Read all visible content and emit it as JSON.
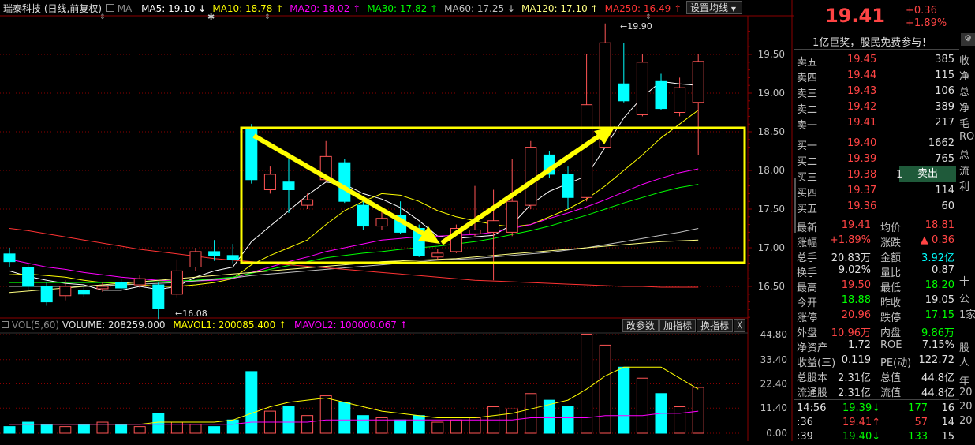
{
  "header": {
    "stock_name": "瑞泰科技",
    "mode": "(日线,前复权)",
    "ma_label": "MA",
    "ma_items": [
      {
        "label": "MA5: 19.10",
        "arrow": "↓",
        "color": "#ffffff"
      },
      {
        "label": "MA10: 18.78",
        "arrow": "↑",
        "color": "#ffff00"
      },
      {
        "label": "MA20: 18.02",
        "arrow": "↑",
        "color": "#ff00ff"
      },
      {
        "label": "MA30: 17.82",
        "arrow": "↑",
        "color": "#00ff00"
      },
      {
        "label": "MA60: 17.25",
        "arrow": "↓",
        "color": "#c0c0c0"
      },
      {
        "label": "MA120: 17.10",
        "arrow": "↑",
        "color": "#ffff80"
      },
      {
        "label": "MA250: 16.49",
        "arrow": "↑",
        "color": "#ff3333"
      }
    ],
    "settings_button": "设置均线"
  },
  "vol_header": {
    "label": "VOL(5,60)",
    "volume": "VOLUME: 208259.000",
    "mavol1": "MAVOL1: 200085.400",
    "mavol2": "MAVOL2: 100000.067",
    "buttons": [
      "改参数",
      "加指标",
      "换指标"
    ],
    "close_glyph": "╳"
  },
  "annotations": {
    "high": "19.90",
    "low": "16.08"
  },
  "colors": {
    "up": "#ff5555",
    "down": "#00ffff",
    "box": "#ffff00"
  },
  "chart_data": {
    "type": "candlestick",
    "price_axis": {
      "ticks": [
        "19.50",
        "19.00",
        "18.50",
        "18.00",
        "17.50",
        "17.00",
        "16.50"
      ],
      "ylim": [
        16.08,
        19.9
      ]
    },
    "volume_axis": {
      "ticks": [
        "44.80",
        "33.40",
        "22.40",
        "11.40",
        "0.00"
      ]
    },
    "candles": [
      {
        "o": 16.92,
        "c": 16.82,
        "h": 17.0,
        "l": 16.75
      },
      {
        "o": 16.75,
        "c": 16.5,
        "h": 16.8,
        "l": 16.45
      },
      {
        "o": 16.5,
        "c": 16.3,
        "h": 16.55,
        "l": 16.25
      },
      {
        "o": 16.38,
        "c": 16.5,
        "h": 16.58,
        "l": 16.32
      },
      {
        "o": 16.45,
        "c": 16.4,
        "h": 16.52,
        "l": 16.36
      },
      {
        "o": 16.47,
        "c": 16.5,
        "h": 16.56,
        "l": 16.43
      },
      {
        "o": 16.55,
        "c": 16.48,
        "h": 16.6,
        "l": 16.45
      },
      {
        "o": 16.52,
        "c": 16.6,
        "h": 16.65,
        "l": 16.48
      },
      {
        "o": 16.52,
        "c": 16.21,
        "h": 16.55,
        "l": 16.08
      },
      {
        "o": 16.4,
        "c": 16.7,
        "h": 16.85,
        "l": 16.35
      },
      {
        "o": 16.75,
        "c": 16.95,
        "h": 17.0,
        "l": 16.7
      },
      {
        "o": 16.95,
        "c": 16.9,
        "h": 17.1,
        "l": 16.83
      },
      {
        "o": 16.9,
        "c": 16.85,
        "h": 17.05,
        "l": 16.8
      },
      {
        "o": 18.53,
        "c": 17.88,
        "h": 18.6,
        "l": 17.83
      },
      {
        "o": 17.75,
        "c": 17.95,
        "h": 18.05,
        "l": 17.7
      },
      {
        "o": 17.85,
        "c": 17.75,
        "h": 18.15,
        "l": 17.45
      },
      {
        "o": 17.55,
        "c": 17.62,
        "h": 17.7,
        "l": 17.5
      },
      {
        "o": 17.88,
        "c": 18.18,
        "h": 18.38,
        "l": 17.85
      },
      {
        "o": 18.1,
        "c": 17.6,
        "h": 18.15,
        "l": 17.58
      },
      {
        "o": 17.55,
        "c": 17.28,
        "h": 17.6,
        "l": 17.23
      },
      {
        "o": 17.28,
        "c": 17.38,
        "h": 17.5,
        "l": 17.23
      },
      {
        "o": 17.42,
        "c": 17.2,
        "h": 17.6,
        "l": 17.18
      },
      {
        "o": 17.25,
        "c": 16.9,
        "h": 17.3,
        "l": 16.88
      },
      {
        "o": 16.88,
        "c": 16.93,
        "h": 16.98,
        "l": 16.85
      },
      {
        "o": 16.95,
        "c": 17.25,
        "h": 17.3,
        "l": 16.93
      },
      {
        "o": 17.18,
        "c": 17.23,
        "h": 17.8,
        "l": 17.15
      },
      {
        "o": 17.2,
        "c": 17.35,
        "h": 17.75,
        "l": 16.58
      },
      {
        "o": 17.2,
        "c": 17.6,
        "h": 18.15,
        "l": 17.15
      },
      {
        "o": 17.55,
        "c": 18.3,
        "h": 18.38,
        "l": 17.5
      },
      {
        "o": 18.2,
        "c": 17.95,
        "h": 18.25,
        "l": 17.9
      },
      {
        "o": 17.95,
        "c": 17.65,
        "h": 18.05,
        "l": 17.5
      },
      {
        "o": 17.65,
        "c": 18.85,
        "h": 19.5,
        "l": 17.6
      },
      {
        "o": 18.3,
        "c": 19.65,
        "h": 19.9,
        "l": 18.35
      },
      {
        "o": 19.12,
        "c": 18.9,
        "h": 19.65,
        "l": 18.88
      },
      {
        "o": 18.72,
        "c": 19.4,
        "h": 19.5,
        "l": 18.7
      },
      {
        "o": 19.15,
        "c": 18.8,
        "h": 19.25,
        "l": 18.78
      },
      {
        "o": 18.75,
        "c": 19.07,
        "h": 19.2,
        "l": 18.7
      },
      {
        "o": 18.88,
        "c": 19.41,
        "h": 19.5,
        "l": 18.2
      }
    ],
    "volumes": [
      3,
      5,
      4,
      3,
      4,
      5,
      4,
      3,
      9,
      5,
      4,
      3,
      6,
      28,
      10,
      12,
      8,
      17,
      14,
      8,
      7,
      6,
      8,
      5,
      6,
      7,
      12,
      11,
      18,
      15,
      12,
      45,
      40,
      30,
      25,
      18,
      12,
      20.8
    ],
    "ma_lines": [
      {
        "name": "MA5",
        "color": "#ffffff",
        "values": [
          16.7,
          16.63,
          16.58,
          16.54,
          16.52,
          16.45,
          16.45,
          16.5,
          16.46,
          16.5,
          16.62,
          16.7,
          16.75,
          17.08,
          17.28,
          17.48,
          17.68,
          17.85,
          17.82,
          17.7,
          17.63,
          17.52,
          17.35,
          17.15,
          17.12,
          17.14,
          17.16,
          17.3,
          17.56,
          17.73,
          17.83,
          17.93,
          18.3,
          18.68,
          18.95,
          19.15,
          19.12,
          19.1
        ]
      },
      {
        "name": "MA10",
        "color": "#ffff00",
        "values": [
          16.65,
          16.66,
          16.64,
          16.62,
          16.58,
          16.55,
          16.54,
          16.52,
          16.5,
          16.5,
          16.52,
          16.55,
          16.6,
          16.78,
          16.9,
          17.0,
          17.1,
          17.3,
          17.48,
          17.6,
          17.7,
          17.68,
          17.6,
          17.48,
          17.4,
          17.35,
          17.3,
          17.27,
          17.3,
          17.4,
          17.5,
          17.63,
          17.8,
          18.0,
          18.2,
          18.42,
          18.6,
          18.78
        ]
      },
      {
        "name": "MA20",
        "color": "#ff00ff",
        "values": [
          16.85,
          16.8,
          16.75,
          16.72,
          16.68,
          16.65,
          16.62,
          16.6,
          16.58,
          16.57,
          16.57,
          16.58,
          16.6,
          16.68,
          16.75,
          16.82,
          16.88,
          16.95,
          17.0,
          17.05,
          17.1,
          17.12,
          17.14,
          17.15,
          17.16,
          17.17,
          17.2,
          17.25,
          17.3,
          17.38,
          17.45,
          17.53,
          17.62,
          17.72,
          17.82,
          17.9,
          17.97,
          18.02
        ]
      },
      {
        "name": "MA30",
        "color": "#00ff00",
        "values": [
          16.55,
          16.55,
          16.55,
          16.55,
          16.55,
          16.55,
          16.55,
          16.56,
          16.56,
          16.57,
          16.58,
          16.6,
          16.62,
          16.67,
          16.72,
          16.77,
          16.82,
          16.87,
          16.9,
          16.93,
          16.95,
          16.98,
          17.0,
          17.02,
          17.05,
          17.08,
          17.12,
          17.17,
          17.22,
          17.28,
          17.35,
          17.42,
          17.5,
          17.58,
          17.65,
          17.72,
          17.78,
          17.82
        ]
      },
      {
        "name": "MA60",
        "color": "#c0c0c0",
        "values": [
          16.5,
          16.5,
          16.5,
          16.5,
          16.5,
          16.51,
          16.52,
          16.53,
          16.54,
          16.55,
          16.57,
          16.59,
          16.61,
          16.64,
          16.66,
          16.68,
          16.7,
          16.72,
          16.74,
          16.76,
          16.78,
          16.8,
          16.82,
          16.84,
          16.85,
          16.86,
          16.88,
          16.9,
          16.92,
          16.94,
          16.97,
          17.0,
          17.04,
          17.08,
          17.12,
          17.16,
          17.2,
          17.25
        ]
      },
      {
        "name": "MA120",
        "color": "#ffff80",
        "values": [
          16.42,
          16.44,
          16.46,
          16.48,
          16.5,
          16.52,
          16.54,
          16.56,
          16.58,
          16.6,
          16.62,
          16.64,
          16.66,
          16.68,
          16.7,
          16.72,
          16.74,
          16.76,
          16.78,
          16.8,
          16.82,
          16.83,
          16.84,
          16.85,
          16.86,
          16.88,
          16.9,
          16.92,
          16.94,
          16.96,
          16.98,
          17.0,
          17.02,
          17.04,
          17.06,
          17.08,
          17.09,
          17.1
        ]
      },
      {
        "name": "MA250",
        "color": "#ff3333",
        "values": [
          17.25,
          17.22,
          17.18,
          17.14,
          17.1,
          17.06,
          17.02,
          16.98,
          16.95,
          16.92,
          16.89,
          16.86,
          16.84,
          16.82,
          16.8,
          16.78,
          16.76,
          16.74,
          16.72,
          16.7,
          16.68,
          16.66,
          16.64,
          16.62,
          16.6,
          16.58,
          16.57,
          16.56,
          16.55,
          16.54,
          16.53,
          16.52,
          16.51,
          16.5,
          16.5,
          16.49,
          16.49,
          16.49
        ]
      }
    ],
    "vol_ma_lines": [
      {
        "name": "MAVOL1",
        "color": "#ffff00",
        "values": [
          4,
          4,
          4,
          4,
          4,
          4,
          4,
          4,
          5,
          5,
          5,
          5,
          6,
          9,
          12,
          14,
          15,
          16,
          14,
          12,
          10,
          9,
          8,
          7,
          7,
          7,
          8,
          9,
          11,
          13,
          15,
          20,
          26,
          30,
          30,
          30,
          25,
          20
        ]
      },
      {
        "name": "MAVOL2",
        "color": "#ff00ff",
        "values": [
          4,
          4,
          4,
          4,
          4,
          4,
          4,
          4,
          4,
          4,
          4,
          4,
          4,
          5,
          5,
          5,
          5,
          6,
          6,
          6,
          6,
          6,
          6,
          6,
          6,
          6,
          6,
          6,
          7,
          7,
          7,
          7,
          8,
          8,
          8,
          9,
          9,
          10
        ]
      }
    ]
  },
  "quote": {
    "price": "19.41",
    "change": "+0.36",
    "change_pct": "+1.89%",
    "promo": "1亿巨奖，股民免费参与！",
    "asks": [
      {
        "label": "卖五",
        "price": "19.45",
        "vol": "385"
      },
      {
        "label": "卖四",
        "price": "19.44",
        "vol": "115"
      },
      {
        "label": "卖三",
        "price": "19.43",
        "vol": "106"
      },
      {
        "label": "卖二",
        "price": "19.42",
        "vol": "389"
      },
      {
        "label": "卖一",
        "price": "19.41",
        "vol": "217"
      }
    ],
    "bids": [
      {
        "label": "买一",
        "price": "19.40",
        "vol": "1662"
      },
      {
        "label": "买二",
        "price": "19.39",
        "vol": "765"
      },
      {
        "label": "买三",
        "price": "19.38",
        "vol": "1"
      },
      {
        "label": "买四",
        "price": "19.37",
        "vol": "114"
      },
      {
        "label": "买五",
        "price": "19.36",
        "vol": "60"
      }
    ],
    "sell_button": "卖出",
    "stats": [
      {
        "l1": "最新",
        "v1": "19.41",
        "c1": "#ff4444",
        "l2": "均价",
        "v2": "18.81",
        "c2": "#ff4444"
      },
      {
        "l1": "涨幅",
        "v1": "+1.89%",
        "c1": "#ff4444",
        "l2": "涨跌",
        "v2": "▲ 0.36",
        "c2": "#ff4444"
      },
      {
        "l1": "总手",
        "v1": "20.83万",
        "c1": "#e0e0e0",
        "l2": "金额",
        "v2": "3.92亿",
        "c2": "#00ffff"
      },
      {
        "l1": "换手",
        "v1": "9.02%",
        "c1": "#e0e0e0",
        "l2": "量比",
        "v2": "0.87",
        "c2": "#e0e0e0"
      },
      {
        "l1": "最高",
        "v1": "19.50",
        "c1": "#ff4444",
        "l2": "最低",
        "v2": "18.20",
        "c2": "#00ff00"
      },
      {
        "l1": "今开",
        "v1": "18.88",
        "c1": "#00ff00",
        "l2": "昨收",
        "v2": "19.05",
        "c2": "#e0e0e0"
      },
      {
        "l1": "涨停",
        "v1": "20.96",
        "c1": "#ff4444",
        "l2": "跌停",
        "v2": "17.15",
        "c2": "#00ff00"
      },
      {
        "l1": "外盘",
        "v1": "10.96万",
        "c1": "#ff4444",
        "l2": "内盘",
        "v2": "9.86万",
        "c2": "#00ff00"
      },
      {
        "l1": "净资产",
        "v1": "1.72",
        "c1": "#e0e0e0",
        "l2": "ROE",
        "v2": "7.15%",
        "c2": "#e0e0e0"
      },
      {
        "l1": "收益(三)",
        "v1": "0.119",
        "c1": "#e0e0e0",
        "l2": "PE(动)",
        "v2": "122.72",
        "c2": "#e0e0e0"
      },
      {
        "l1": "总股本",
        "v1": "2.31亿",
        "c1": "#e0e0e0",
        "l2": "总值",
        "v2": "44.8亿",
        "c2": "#e0e0e0"
      },
      {
        "l1": "流通股",
        "v1": "2.31亿",
        "c1": "#e0e0e0",
        "l2": "流值",
        "v2": "44.8亿",
        "c2": "#e0e0e0"
      }
    ],
    "ticks": [
      {
        "time": "14:56",
        "price": "19.39",
        "arrow": "↓",
        "vol": "177",
        "num": "16",
        "color": "#00ff00"
      },
      {
        "time": ":36",
        "price": "19.41",
        "arrow": "↑",
        "vol": "57",
        "num": "14",
        "color": "#ff4444"
      },
      {
        "time": ":39",
        "price": "19.40",
        "arrow": "↓",
        "vol": "133",
        "num": "15",
        "color": "#00ff00"
      }
    ],
    "side_cut": [
      "收",
      "净",
      "总",
      "净",
      "毛",
      "RO",
      "总",
      "流",
      "利",
      "十",
      "公",
      "1家",
      "股",
      "人",
      "年",
      "20",
      "20",
      "20"
    ]
  }
}
